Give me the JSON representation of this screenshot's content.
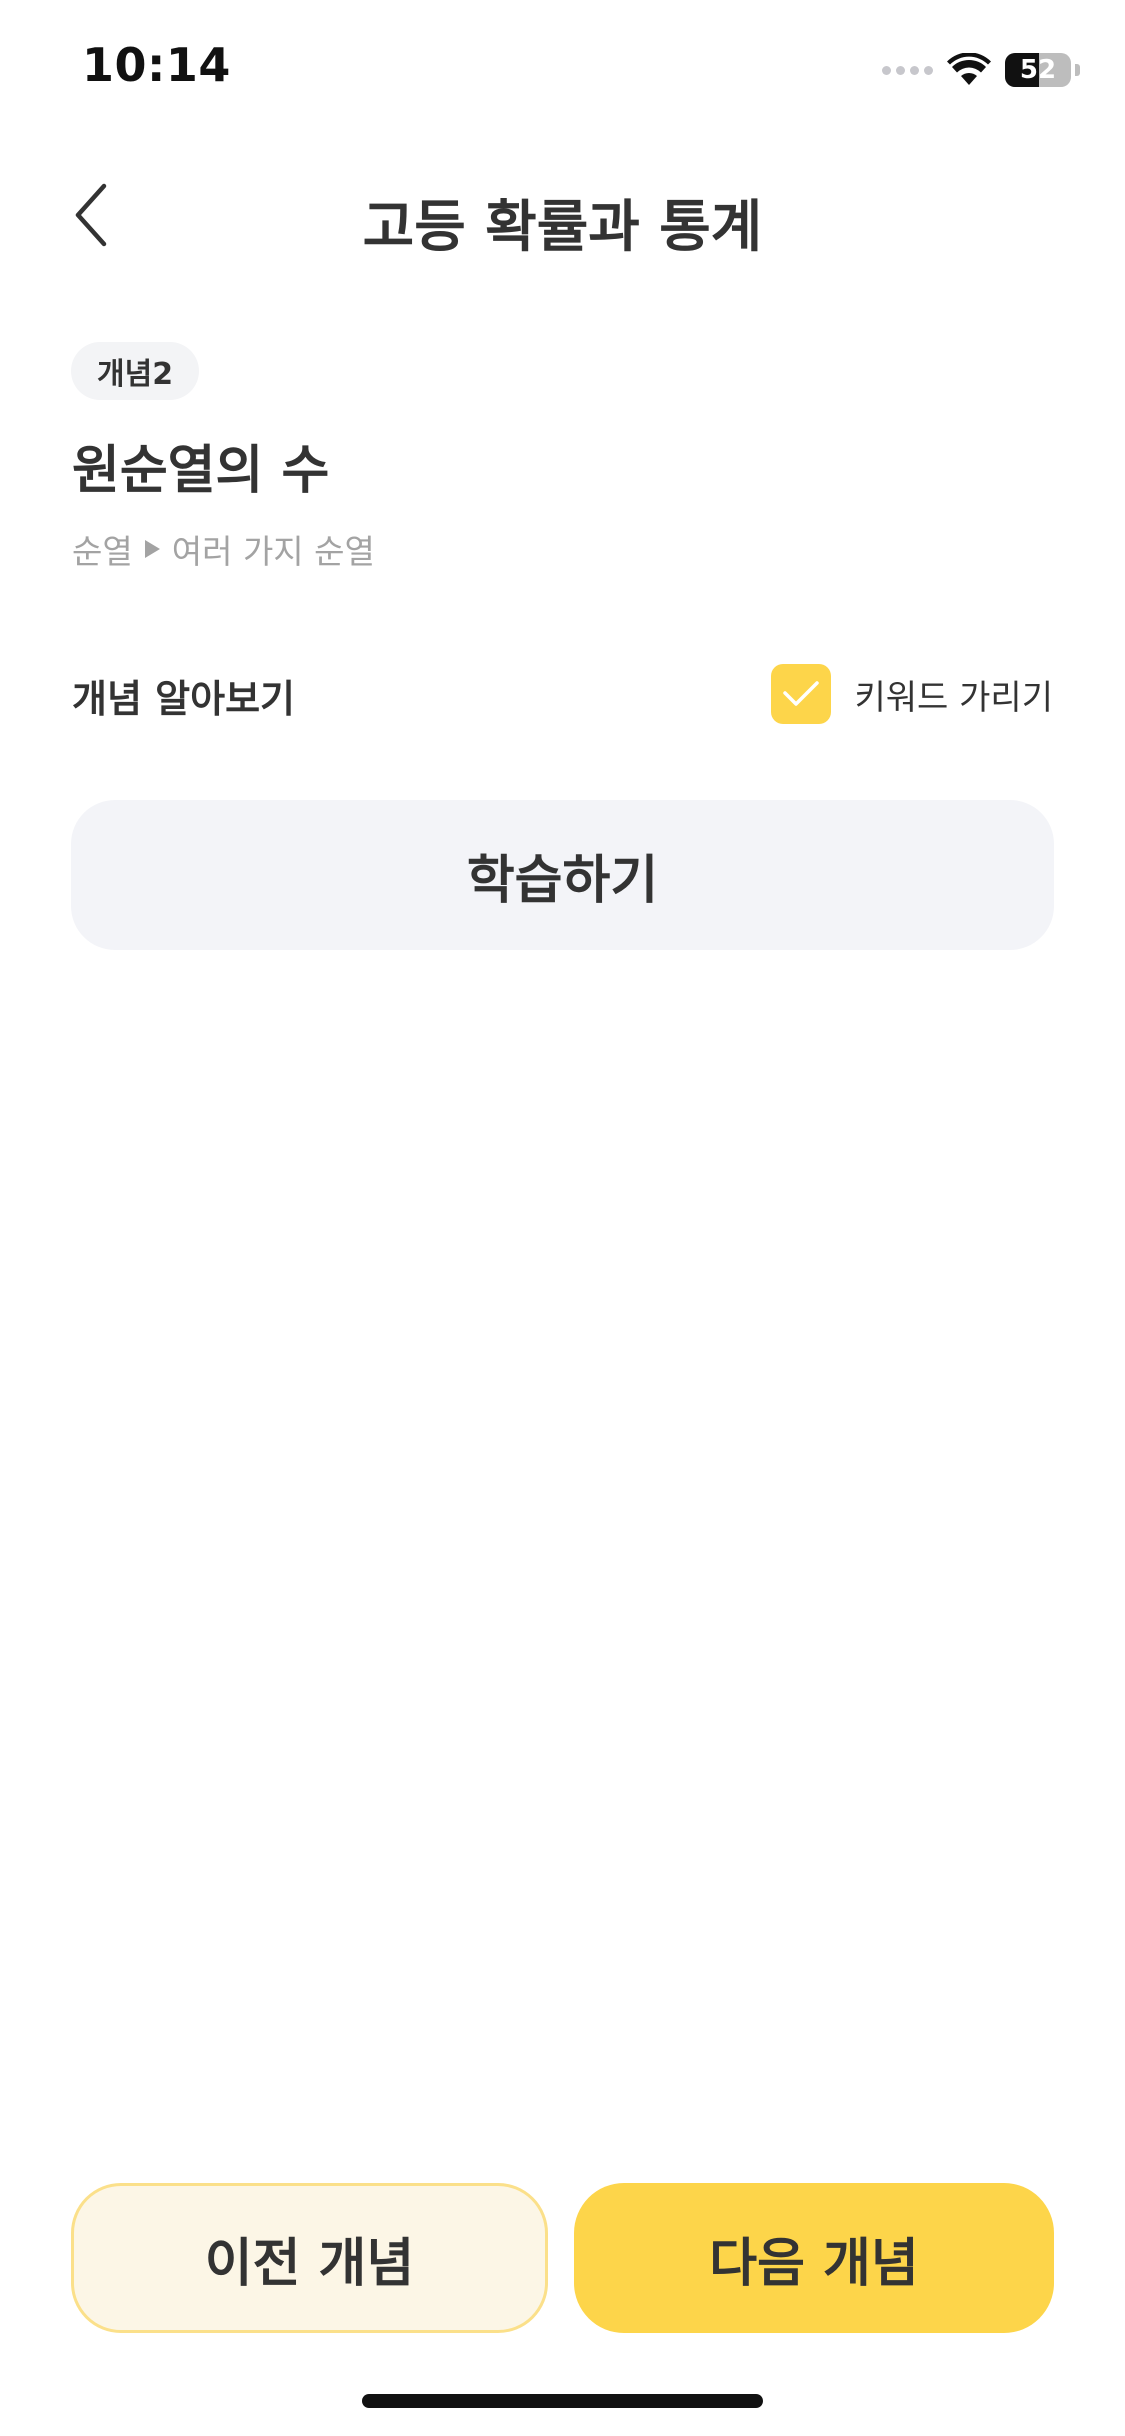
{
  "status_bar": {
    "time": "10:14",
    "battery_level": "52",
    "battery_fraction": 0.52
  },
  "header": {
    "title": "고등 확률과 통계",
    "back_icon": "chevron-left-icon"
  },
  "concept": {
    "badge": "개념2",
    "title": "원순열의 수",
    "breadcrumb": {
      "parent": "순열",
      "current": "여러 가지 순열",
      "separator_icon": "triangle-right-icon"
    }
  },
  "section": {
    "heading": "개념 알아보기",
    "keyword_toggle": {
      "label": "키워드 가리기",
      "checked": true,
      "checkbox_color": "#fdd54a"
    }
  },
  "study_button": {
    "label": "학습하기"
  },
  "bottom_nav": {
    "prev_label": "이전 개념",
    "next_label": "다음 개념",
    "accent_color": "#fdd54a"
  }
}
